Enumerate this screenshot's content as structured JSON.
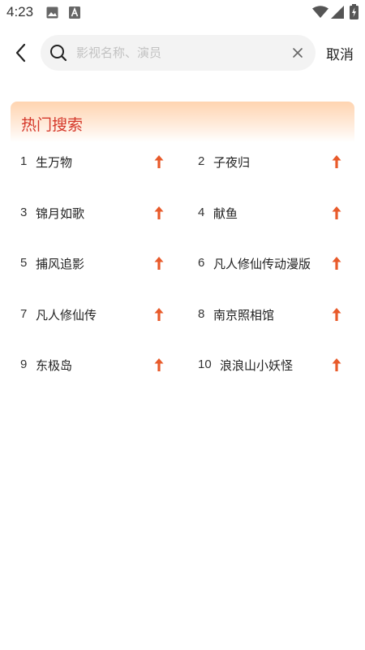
{
  "status_bar": {
    "time": "4:23",
    "icons": [
      "image-icon",
      "font-a-icon",
      "wifi-icon",
      "signal-icon",
      "battery-charging-icon"
    ]
  },
  "header": {
    "back_icon": "chevron-left-icon",
    "search": {
      "placeholder": "影视名称、演员",
      "value": ""
    },
    "cancel_label": "取消"
  },
  "hot_search": {
    "title": "热门搜索",
    "trend_color": "#e85a2a",
    "items": [
      {
        "rank": "1",
        "name": "生万物"
      },
      {
        "rank": "2",
        "name": "子夜归"
      },
      {
        "rank": "3",
        "name": "锦月如歌"
      },
      {
        "rank": "4",
        "name": "献鱼"
      },
      {
        "rank": "5",
        "name": "捕风追影"
      },
      {
        "rank": "6",
        "name": "凡人修仙传动漫版"
      },
      {
        "rank": "7",
        "name": "凡人修仙传"
      },
      {
        "rank": "8",
        "name": "南京照相馆"
      },
      {
        "rank": "9",
        "name": "东极岛"
      },
      {
        "rank": "10",
        "name": "浪浪山小妖怪"
      }
    ]
  }
}
